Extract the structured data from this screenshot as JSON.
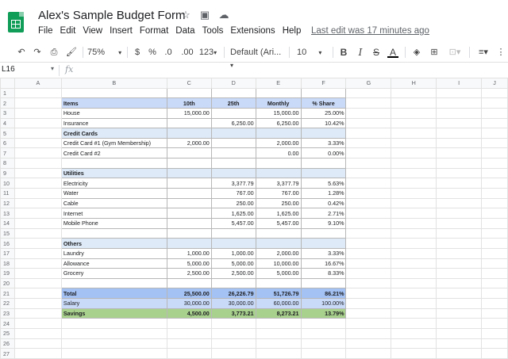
{
  "app": {
    "doc_title": "Alex's Sample Budget Form",
    "last_edit": "Last edit was 17 minutes ago",
    "menu": [
      "File",
      "Edit",
      "View",
      "Insert",
      "Format",
      "Data",
      "Tools",
      "Extensions",
      "Help"
    ],
    "title_icons": [
      "star-icon",
      "move-to-folder-icon",
      "cloud-status-icon"
    ]
  },
  "toolbar": {
    "zoom": "75%",
    "currency": "$",
    "percent": "%",
    "dec_decrease": ".0",
    "dec_increase": ".00",
    "more_formats": "123",
    "font": "Default (Ari...",
    "font_size": "10",
    "bold": "B",
    "italic": "I",
    "strike": "S",
    "text_color": "A"
  },
  "formula_bar": {
    "name_box": "L16",
    "fx": "fx",
    "content": ""
  },
  "columns": [
    "A",
    "B",
    "C",
    "D",
    "E",
    "F",
    "G",
    "H",
    "I",
    "J"
  ],
  "rows": [
    {
      "n": "1",
      "type": "blank",
      "cells": [
        "",
        "",
        "",
        "",
        ""
      ]
    },
    {
      "n": "2",
      "type": "hdr",
      "cells": [
        "Items",
        "10th",
        "25th",
        "Monthly",
        "% Share"
      ]
    },
    {
      "n": "3",
      "type": "data",
      "cells": [
        "House",
        "15,000.00",
        "",
        "15,000.00",
        "25.00%"
      ]
    },
    {
      "n": "4",
      "type": "data",
      "cells": [
        "Insurance",
        "",
        "6,250.00",
        "6,250.00",
        "10.42%"
      ]
    },
    {
      "n": "5",
      "type": "sec",
      "cells": [
        "Credit Cards",
        "",
        "",
        "",
        ""
      ]
    },
    {
      "n": "6",
      "type": "data",
      "cells": [
        "Credit Card #1 (Gym Membership)",
        "2,000.00",
        "",
        "2,000.00",
        "3.33%"
      ]
    },
    {
      "n": "7",
      "type": "data",
      "cells": [
        "Credit Card #2",
        "",
        "",
        "0.00",
        "0.00%"
      ]
    },
    {
      "n": "8",
      "type": "blank",
      "cells": [
        "",
        "",
        "",
        "",
        ""
      ]
    },
    {
      "n": "9",
      "type": "sec",
      "cells": [
        "Utilities",
        "",
        "",
        "",
        ""
      ]
    },
    {
      "n": "10",
      "type": "data",
      "cells": [
        "Electricity",
        "",
        "3,377.79",
        "3,377.79",
        "5.63%"
      ]
    },
    {
      "n": "11",
      "type": "data",
      "cells": [
        "Water",
        "",
        "767.00",
        "767.00",
        "1.28%"
      ]
    },
    {
      "n": "12",
      "type": "data",
      "cells": [
        "Cable",
        "",
        "250.00",
        "250.00",
        "0.42%"
      ]
    },
    {
      "n": "13",
      "type": "data",
      "cells": [
        "Internet",
        "",
        "1,625.00",
        "1,625.00",
        "2.71%"
      ]
    },
    {
      "n": "14",
      "type": "data",
      "cells": [
        "Mobile Phone",
        "",
        "5,457.00",
        "5,457.00",
        "9.10%"
      ]
    },
    {
      "n": "15",
      "type": "blank",
      "cells": [
        "",
        "",
        "",
        "",
        ""
      ]
    },
    {
      "n": "16",
      "type": "sec",
      "cells": [
        "Others",
        "",
        "",
        "",
        ""
      ]
    },
    {
      "n": "17",
      "type": "data",
      "cells": [
        "Laundry",
        "1,000.00",
        "1,000.00",
        "2,000.00",
        "3.33%"
      ]
    },
    {
      "n": "18",
      "type": "data",
      "cells": [
        "Allowance",
        "5,000.00",
        "5,000.00",
        "10,000.00",
        "16.67%"
      ]
    },
    {
      "n": "19",
      "type": "data",
      "cells": [
        "Grocery",
        "2,500.00",
        "2,500.00",
        "5,000.00",
        "8.33%"
      ]
    },
    {
      "n": "20",
      "type": "blank",
      "cells": [
        "",
        "",
        "",
        "",
        ""
      ]
    },
    {
      "n": "21",
      "type": "tot",
      "cells": [
        "Total",
        "25,500.00",
        "26,226.79",
        "51,726.79",
        "86.21%"
      ]
    },
    {
      "n": "22",
      "type": "sal",
      "cells": [
        "Salary",
        "30,000.00",
        "30,000.00",
        "60,000.00",
        "100.00%"
      ]
    },
    {
      "n": "23",
      "type": "sav",
      "cells": [
        "Savings",
        "4,500.00",
        "3,773.21",
        "8,273.21",
        "13.79%"
      ]
    },
    {
      "n": "24",
      "type": "empty",
      "cells": [
        "",
        "",
        "",
        "",
        ""
      ]
    },
    {
      "n": "25",
      "type": "empty",
      "cells": [
        "",
        "",
        "",
        "",
        ""
      ]
    },
    {
      "n": "26",
      "type": "empty",
      "cells": [
        "",
        "",
        "",
        "",
        ""
      ]
    },
    {
      "n": "27",
      "type": "empty",
      "cells": [
        "",
        "",
        "",
        "",
        ""
      ]
    }
  ]
}
